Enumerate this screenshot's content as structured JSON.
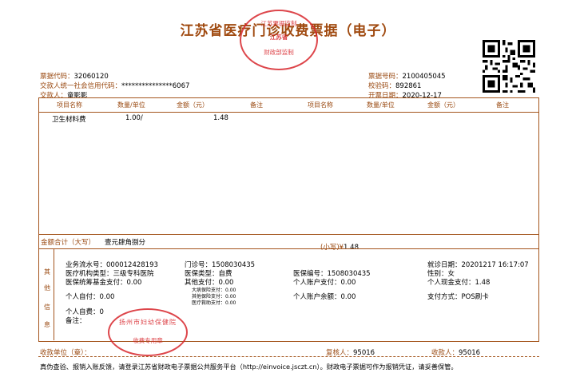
{
  "title": "江苏省医疗门诊收费票据（电子）",
  "header_left": {
    "code_label": "票据代码：",
    "code": "32060120",
    "credit_label": "交款人统一社会信用代码：",
    "credit": "***************6067",
    "payer_label": "交款人：",
    "payer": "童影影"
  },
  "header_right": {
    "number_label": "票据号码：",
    "number": "2100405045",
    "check_label": "校验码：",
    "check": "892861",
    "date_label": "开票日期：",
    "date": "2020-12-17"
  },
  "table": {
    "columns": [
      "项目名称",
      "数量/单位",
      "金额（元）",
      "备注",
      "项目名称",
      "数量/单位",
      "金额（元）",
      "备注"
    ],
    "rows": [
      {
        "name": "卫生材料费",
        "qty": "1.00/",
        "amount": "1.48",
        "note": ""
      }
    ]
  },
  "total": {
    "label": "金额合计（大写）",
    "upper": "壹元肆角捌分",
    "small_label": "(小写)¥",
    "small": "1.48"
  },
  "other": {
    "side_label": [
      "其",
      "他",
      "信",
      "息"
    ],
    "serial_label": "业务流水号：",
    "serial": "000012428193",
    "clinic_label": "门诊号：",
    "clinic": "1508030435",
    "visit_label": "就诊日期：",
    "visit": "20201217  16:17:07",
    "org_label": "医疗机构类型：",
    "org": "三级专科医院",
    "ins_type_label": "医保类型：",
    "ins_type": "自费",
    "ins_no_label": "医保编号：",
    "ins_no": "1508030435",
    "gender_label": "性别：",
    "gender": "女",
    "fund_label": "医保统筹基金支付：",
    "fund": "0.00",
    "other_pay_label": "其他支付：",
    "other_pay": "0.00",
    "acct_pay_label": "个人账户支付：",
    "acct_pay": "0.00",
    "cash_label": "个人现金支付：",
    "cash": "1.48",
    "big_ins_label": "大病保险支付：",
    "big_ins": "0.00",
    "other_ins_label": "其他保险支付：",
    "other_ins": "0.00",
    "aid_label": "医疗救助支付：",
    "aid": "0.00",
    "self_label": "个人自付：",
    "self": "0.00",
    "balance_label": "个人账户余额：",
    "balance": "0.00",
    "method_label": "支付方式：",
    "method": "POS刷卡",
    "selfpay_label": "个人自费：",
    "selfpay": "0",
    "remark_label": "备注："
  },
  "footer": {
    "unit_label": "收款单位（章）：",
    "reviewer_label": "复核人：",
    "reviewer": "95016",
    "cashier_label": "收款人：",
    "cashier": "95016",
    "notice": "真伪查验、报销入账反馈，请登录江苏省财政电子票据公共服务平台（http://einvoice.jsczt.cn）。财政电子票据可作为报销凭证，请妥善保管。"
  },
  "seal_top": {
    "line1": "江苏票据监制",
    "line2": "江苏省",
    "line3": "财政部监制"
  },
  "seal_bottom": {
    "line1": "扬州市妇幼保健院",
    "line2": "收费专用章"
  },
  "colors": {
    "accent": "#9a4a12",
    "seal": "#d8262c"
  }
}
